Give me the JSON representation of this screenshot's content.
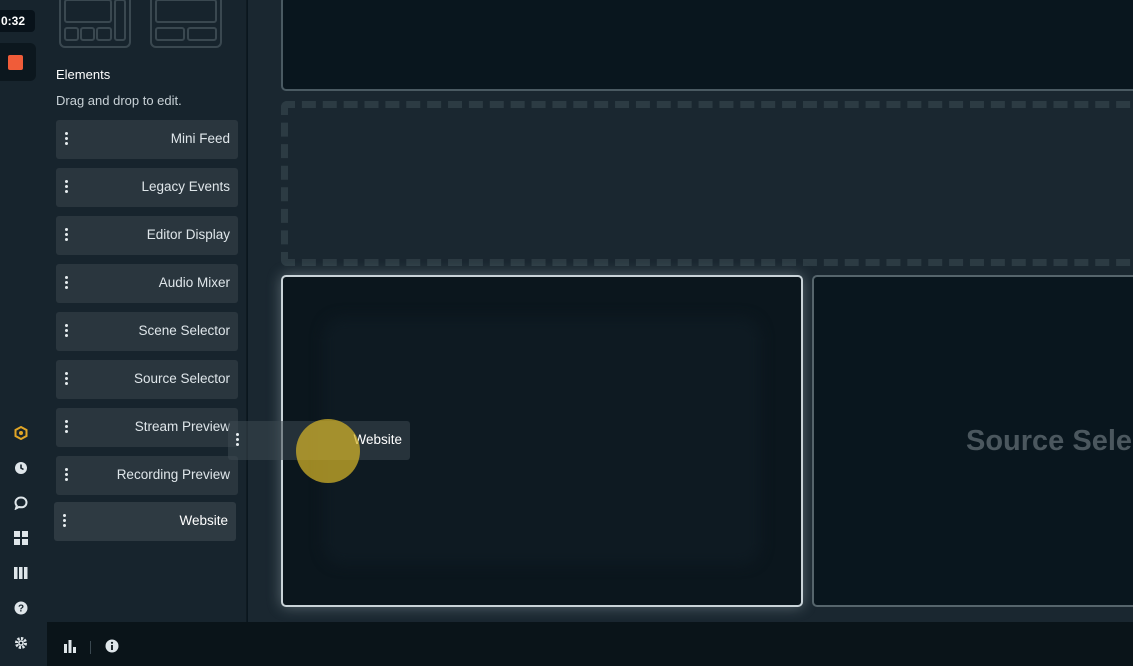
{
  "rail": {
    "timer": "0:32",
    "icons": [
      "studio-mode-icon",
      "clock-icon",
      "chat-icon",
      "layout-icon",
      "library-icon",
      "help-icon",
      "settings-icon"
    ]
  },
  "panel": {
    "title": "Elements",
    "subtitle": "Drag and drop to edit.",
    "items": [
      {
        "label": "Mini Feed"
      },
      {
        "label": "Legacy Events"
      },
      {
        "label": "Editor Display"
      },
      {
        "label": "Audio Mixer"
      },
      {
        "label": "Scene Selector"
      },
      {
        "label": "Source Selector"
      },
      {
        "label": "Stream Preview"
      },
      {
        "label": "Recording Preview"
      },
      {
        "label": "Website"
      }
    ]
  },
  "canvas": {
    "drag_ghost_label": "Website",
    "source_box_label": "Source Sele"
  },
  "colors": {
    "record_stop": "#f05c39",
    "cursor_halo": "#d6b428",
    "studio_icon": "#e0a526"
  }
}
